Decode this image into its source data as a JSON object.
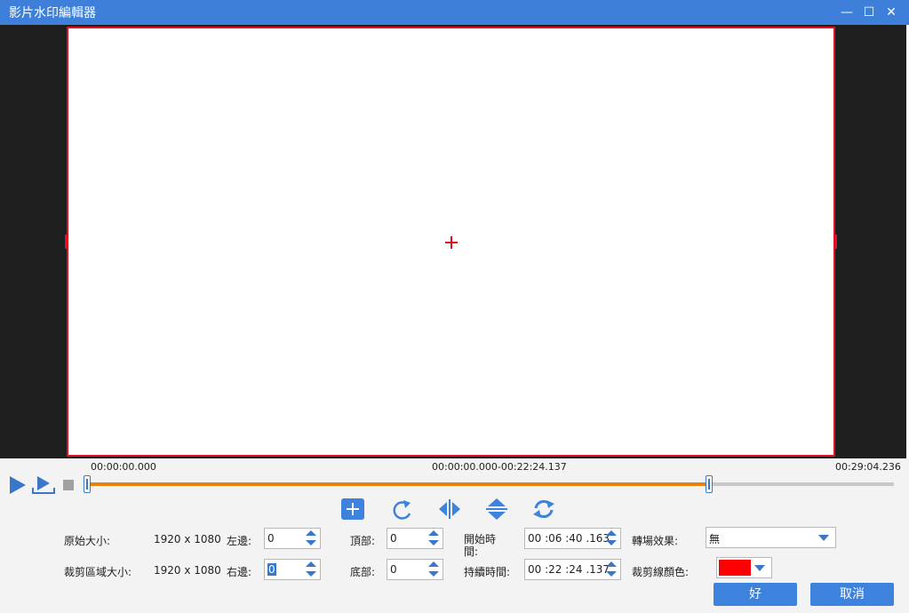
{
  "window": {
    "title": "影片水印編輯器",
    "controls": {
      "minimize": "—",
      "maximize": "☐",
      "close": "✕"
    }
  },
  "colors": {
    "titlebar": "#3d7fd9",
    "accent": "#3d82dc",
    "crop_line": "#e01020",
    "timeline_fill": "#e8820f"
  },
  "timeline": {
    "start": "00:00:00.000",
    "range": "00:00:00.000-00:22:24.137",
    "end": "00:29:04.236",
    "selection_end_fraction": 0.771
  },
  "toolbar_icons": [
    "add-icon",
    "rotate-icon",
    "flip-horizontal-icon",
    "flip-vertical-icon",
    "refresh-icon"
  ],
  "form": {
    "original_size_label": "原始大小:",
    "original_size_value": "1920 x 1080",
    "crop_size_label": "裁剪區域大小:",
    "crop_size_value": "1920 x 1080",
    "left_label": "左邊:",
    "left_value": "0",
    "right_label": "右邊:",
    "right_value": "0",
    "top_label": "頂部:",
    "top_value": "0",
    "bottom_label": "底部:",
    "bottom_value": "0",
    "start_time_label_1": "開始時",
    "start_time_label_2": "間:",
    "start_time_value": "00 :06 :40 .163",
    "duration_label": "持續時間:",
    "duration_value": "00 :22 :24 .137",
    "transition_label": "轉場效果:",
    "transition_value": "無",
    "crop_color_label": "裁剪線顏色:",
    "crop_color_value": "#ff0000"
  },
  "buttons": {
    "ok": "好",
    "cancel": "取消"
  }
}
